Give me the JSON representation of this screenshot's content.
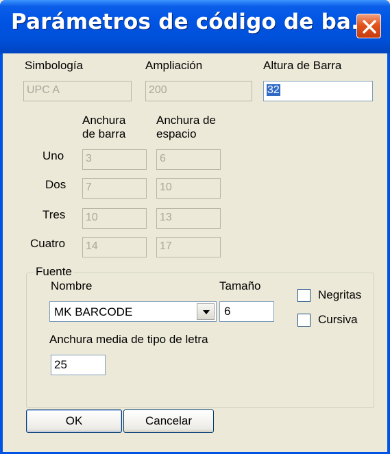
{
  "window": {
    "title": "Parámetros de código de ba..."
  },
  "labels": {
    "symbology": "Simbología",
    "magnification": "Ampliación",
    "bar_height": "Altura de Barra",
    "bar_width_col_l1": "Anchura",
    "bar_width_col_l2": "de barra",
    "space_width_col_l1": "Anchura de",
    "space_width_col_l2": "espacio"
  },
  "fields": {
    "symbology": "UPC A",
    "magnification": "200",
    "bar_height": "32"
  },
  "rows": [
    {
      "label": "Uno",
      "bar": "3",
      "space": "6"
    },
    {
      "label": "Dos",
      "bar": "7",
      "space": "10"
    },
    {
      "label": "Tres",
      "bar": "10",
      "space": "13"
    },
    {
      "label": "Cuatro",
      "bar": "14",
      "space": "17"
    }
  ],
  "font_group": {
    "legend": "Fuente",
    "name_label": "Nombre",
    "name_value": "MK BARCODE",
    "size_label": "Tamaño",
    "size_value": "6",
    "bold_label": "Negritas",
    "bold_checked": false,
    "italic_label": "Cursiva",
    "italic_checked": false,
    "avg_width_label": "Anchura media de tipo de letra",
    "avg_width_value": "25"
  },
  "buttons": {
    "ok": "OK",
    "cancel": "Cancelar"
  },
  "icons": {
    "close": "close-icon",
    "dropdown": "chevron-down-icon"
  },
  "colors": {
    "titlebar": "#0054e3",
    "close_button": "#e3541c",
    "dialog_bg": "#ece9d8",
    "selection": "#316ac5"
  }
}
